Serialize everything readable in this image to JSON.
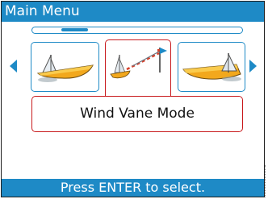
{
  "title": "Main Menu",
  "icons": {
    "left": "autopilot-boat-left-icon",
    "center": "wind-vane-icon",
    "right": "autopilot-boat-right-icon"
  },
  "mode_label": "Wind Vane Mode",
  "status_text": "Press ENTER to select.",
  "colors": {
    "accent": "#1e8ac6",
    "selection": "#c8191c",
    "boat_hull": "#f2a81d"
  }
}
